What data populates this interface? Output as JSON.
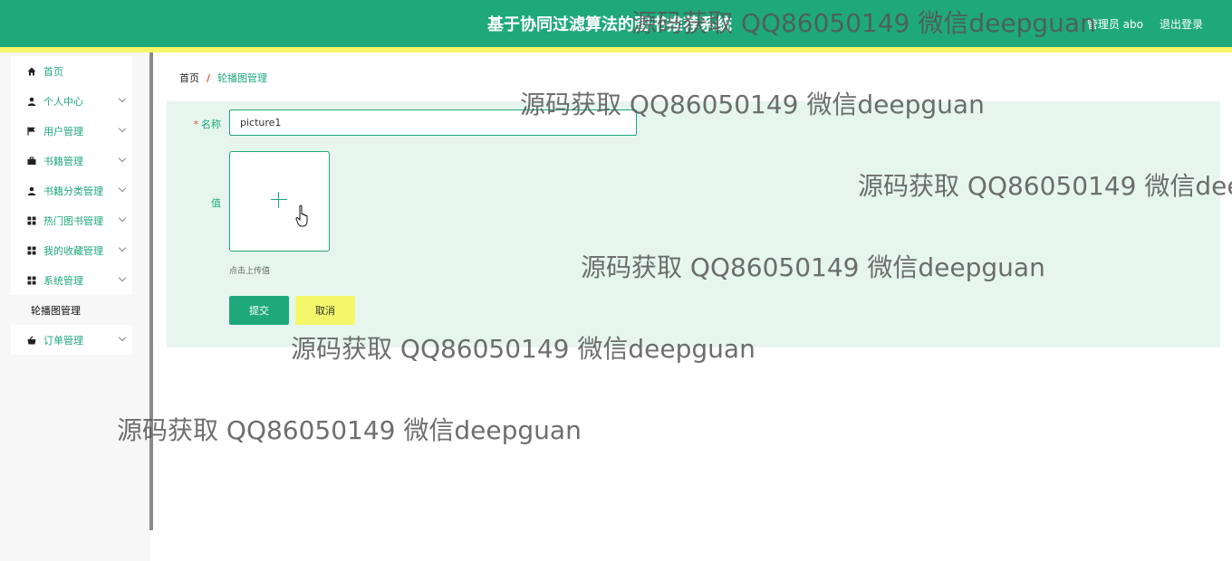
{
  "header": {
    "title": "基于协同过滤算法的图书推荐系统",
    "user_label": "管理员 abo",
    "logout_label": "退出登录"
  },
  "sidebar": {
    "items": [
      {
        "label": "首页",
        "icon": "home-icon"
      },
      {
        "label": "个人中心",
        "icon": "user-icon"
      },
      {
        "label": "用户管理",
        "icon": "flag-icon"
      },
      {
        "label": "书籍管理",
        "icon": "briefcase-icon"
      },
      {
        "label": "书籍分类管理",
        "icon": "user-icon"
      },
      {
        "label": "热门图书管理",
        "icon": "grid-icon"
      },
      {
        "label": "我的收藏管理",
        "icon": "grid-icon"
      },
      {
        "label": "系统管理",
        "icon": "grid-icon"
      },
      {
        "label": "轮播图管理",
        "icon": ""
      },
      {
        "label": "订单管理",
        "icon": "cart-icon"
      }
    ]
  },
  "breadcrumb": {
    "home": "首页",
    "separator": "/",
    "current": "轮播图管理"
  },
  "form": {
    "name_label": "名称",
    "name_value": "picture1",
    "value_label": "值",
    "upload_hint": "点击上传值",
    "submit_label": "提交",
    "cancel_label": "取消"
  },
  "watermark": {
    "text": "源码获取 QQ86050149 微信deepguan"
  },
  "colors": {
    "primary": "#1fa97a",
    "accent_yellow": "#f5f76b",
    "panel_bg": "#e6f6ef",
    "required": "#e0542c"
  }
}
